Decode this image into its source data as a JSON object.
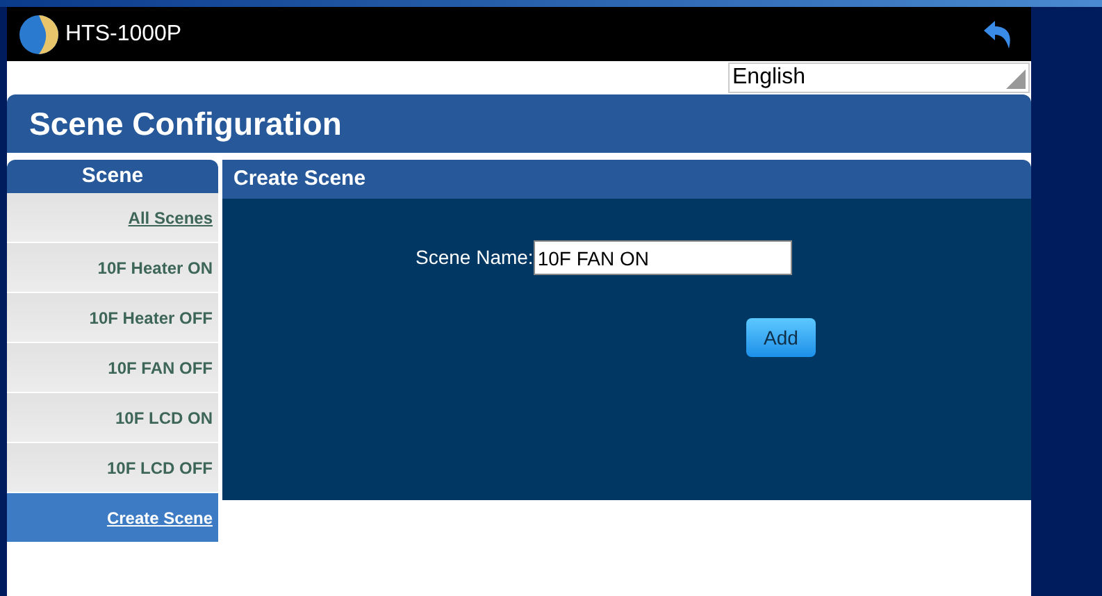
{
  "app_bar": {
    "title": "HTS-1000P"
  },
  "language_select": {
    "value": "English"
  },
  "page_header": {
    "title": "Scene Configuration"
  },
  "sidebar": {
    "title": "Scene",
    "items": [
      {
        "label": "All Scenes",
        "kind": "link",
        "selected": false
      },
      {
        "label": "10F Heater ON",
        "kind": "scene",
        "selected": false
      },
      {
        "label": "10F Heater OFF",
        "kind": "scene",
        "selected": false
      },
      {
        "label": "10F FAN OFF",
        "kind": "scene",
        "selected": false
      },
      {
        "label": "10F LCD ON",
        "kind": "scene",
        "selected": false
      },
      {
        "label": "10F LCD OFF",
        "kind": "scene",
        "selected": false
      },
      {
        "label": "Create Scene",
        "kind": "link",
        "selected": true
      }
    ]
  },
  "panel": {
    "title": "Create Scene",
    "field_label": "Scene Name:",
    "field_value": "10F FAN ON",
    "button": "Add"
  }
}
